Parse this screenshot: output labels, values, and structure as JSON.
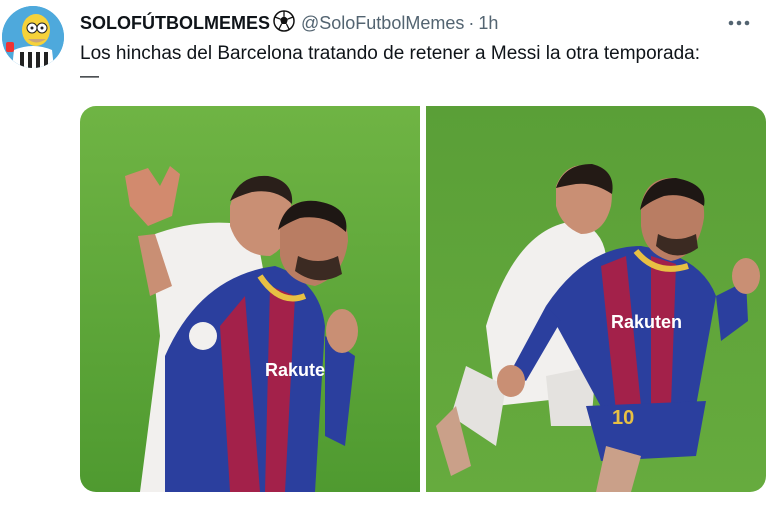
{
  "tweet": {
    "display_name": "SOLOFÚTBOLMEMES",
    "handle": "@SoloFutbolMemes",
    "separator": "·",
    "time": "1h",
    "text": "Los hinchas del Barcelona tratando de retener a Messi la otra temporada:",
    "text_line2": "—",
    "verified_emoji_icon": "soccer-ball-icon",
    "more_icon": "ellipsis-icon"
  },
  "media": {
    "left_photo": {
      "jersey_text": "Rakuten",
      "player_number": ""
    },
    "right_photo": {
      "jersey_text": "Rakuten",
      "player_number": "10"
    }
  },
  "colors": {
    "pitch_green": "#5fa63a",
    "barca_blue": "#2b3f9e",
    "barca_red": "#a3214a",
    "sevilla_white": "#f2f0ee",
    "text_secondary": "#536471"
  }
}
